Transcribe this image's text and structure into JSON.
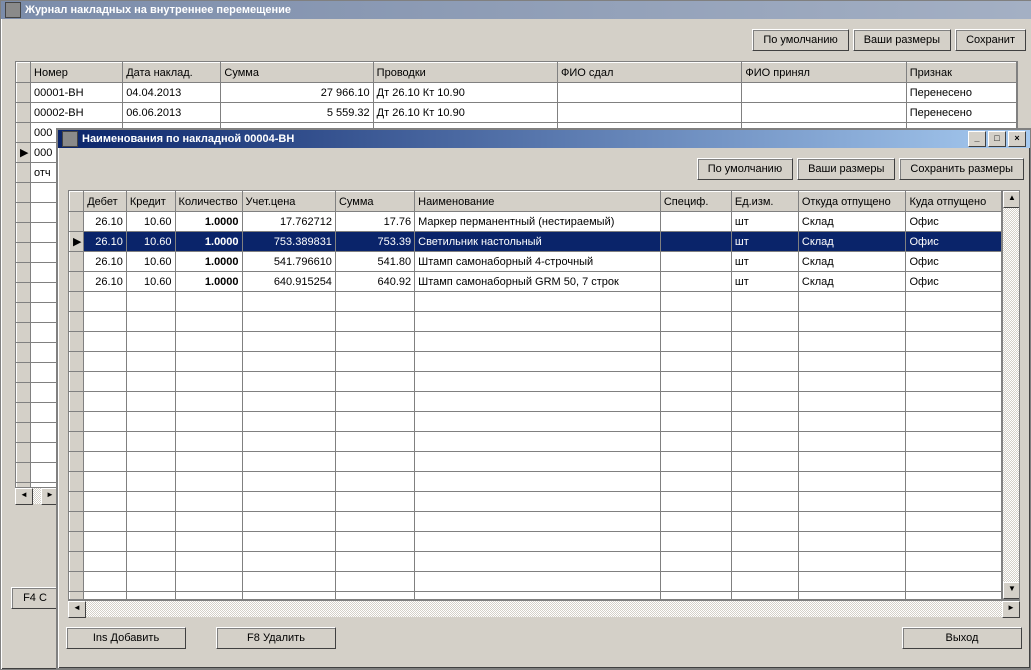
{
  "outer": {
    "title": "Журнал накладных на внутреннее перемещение",
    "toolbar": {
      "default_btn": "По умолчанию",
      "your_sizes_btn": "Ваши размеры",
      "save_btn_partial": "Сохранит"
    },
    "columns": {
      "number": "Номер",
      "date": "Дата наклад.",
      "sum": "Сумма",
      "entries": "Проводки",
      "fio_gave": "ФИО сдал",
      "fio_took": "ФИО принял",
      "flag": "Признак"
    },
    "rows": [
      {
        "number": "00001-ВН",
        "date": "04.04.2013",
        "sum": "27 966.10",
        "entries": "Дт 26.10 Кт 10.90",
        "fio_gave": "",
        "fio_took": "",
        "flag": "Перенесено"
      },
      {
        "number": "00002-ВН",
        "date": "06.06.2013",
        "sum": "5 559.32",
        "entries": "Дт 26.10 Кт 10.90",
        "fio_gave": "",
        "fio_took": "",
        "flag": "Перенесено"
      }
    ],
    "partial_rows": [
      {
        "number_partial": "000"
      },
      {
        "marker": "▶",
        "number_partial": "000"
      },
      {
        "number_partial": "отч"
      }
    ],
    "footer_btn_partial": "F4 С"
  },
  "inner": {
    "title": "Наименования по накладной 00004-ВН",
    "toolbar": {
      "default_btn": "По умолчанию",
      "your_sizes_btn": "Ваши размеры",
      "save_sizes_btn": "Сохранить размеры"
    },
    "columns": {
      "debit": "Дебет",
      "credit": "Кредит",
      "qty": "Количество",
      "acct_price": "Учет.цена",
      "sum": "Сумма",
      "name": "Наименование",
      "spec": "Специф.",
      "unit": "Ед.изм.",
      "from": "Откуда отпущено",
      "to": "Куда отпущено"
    },
    "rows": [
      {
        "debit": "26.10",
        "credit": "10.60",
        "qty": "1.0000",
        "price": "17.762712",
        "sum": "17.76",
        "name": "Маркер перманентный (нестираемый)",
        "spec": "",
        "unit": "шт",
        "from": "Склад",
        "to": "Офис"
      },
      {
        "debit": "26.10",
        "credit": "10.60",
        "qty": "1.0000",
        "price": "753.389831",
        "sum": "753.39",
        "name": "Светильник настольный",
        "spec": "",
        "unit": "шт",
        "from": "Склад",
        "to": "Офис",
        "selected": true
      },
      {
        "debit": "26.10",
        "credit": "10.60",
        "qty": "1.0000",
        "price": "541.796610",
        "sum": "541.80",
        "name": "Штамп самонаборный 4-строчный",
        "spec": "",
        "unit": "шт",
        "from": "Склад",
        "to": "Офис"
      },
      {
        "debit": "26.10",
        "credit": "10.60",
        "qty": "1.0000",
        "price": "640.915254",
        "sum": "640.92",
        "name": "Штамп самонаборный GRM 50, 7 строк",
        "spec": "",
        "unit": "шт",
        "from": "Склад",
        "to": "Офис"
      }
    ],
    "footer": {
      "ins_add": "Ins Добавить",
      "f8_delete": "F8 Удалить",
      "exit": "Выход"
    }
  }
}
